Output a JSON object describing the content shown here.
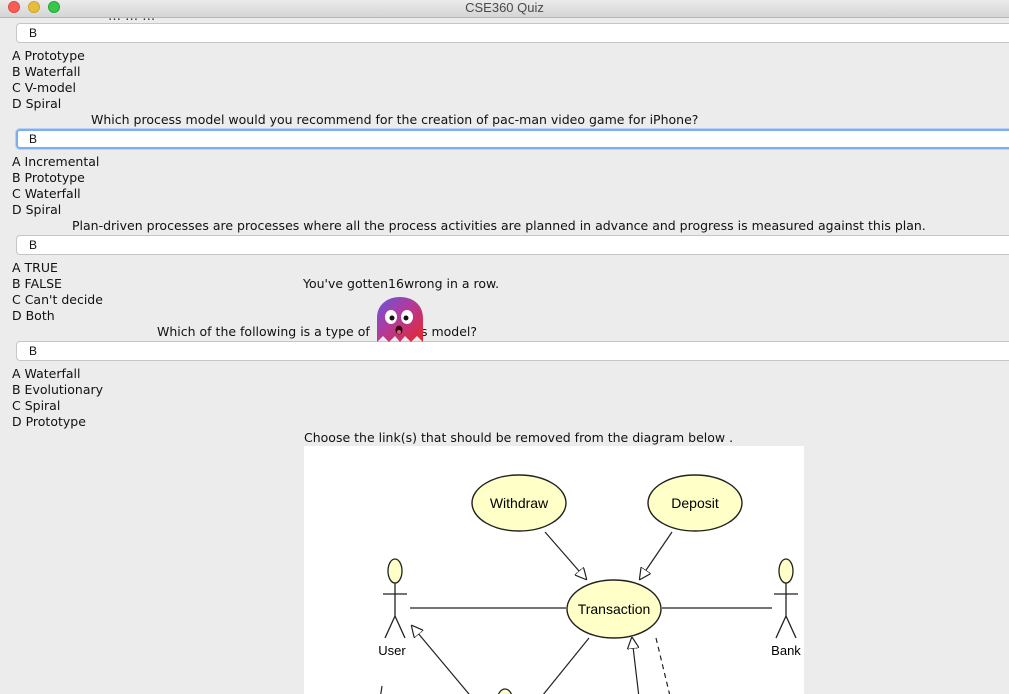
{
  "window": {
    "title": "CSE360 Quiz"
  },
  "clipped_top_text": "… … …",
  "questions": [
    {
      "answer": "B",
      "options": [
        "A Prototype",
        "B Waterfall",
        "C V-model",
        "D Spiral"
      ]
    },
    {
      "text": "Which process model would you recommend for the creation of pac-man video game for iPhone?",
      "answer": "B",
      "options": [
        "A Incremental",
        "B Prototype",
        "C Waterfall",
        "D Spiral"
      ]
    },
    {
      "text": "Plan-driven processes are processes where all the process activities are planned in advance and progress is measured against this plan.",
      "answer": "B",
      "options": [
        "A TRUE",
        "B FALSE",
        "C Can't decide",
        "D Both"
      ]
    },
    {
      "text": "Which of the following is a type of",
      "text_end": "s model?",
      "answer": "B",
      "options": [
        "A Waterfall",
        "B Evolutionary",
        "C Spiral",
        "D Prototype"
      ]
    },
    {
      "text": "Choose the link(s) that should be removed from the diagram below ."
    }
  ],
  "streak_message": "You've gotten16wrong in a row.",
  "ghost_icon": "ghost-mascot-icon",
  "diagram": {
    "use_cases": [
      "Withdraw",
      "Deposit",
      "Transaction"
    ],
    "actors": [
      "User",
      "Bank"
    ]
  }
}
